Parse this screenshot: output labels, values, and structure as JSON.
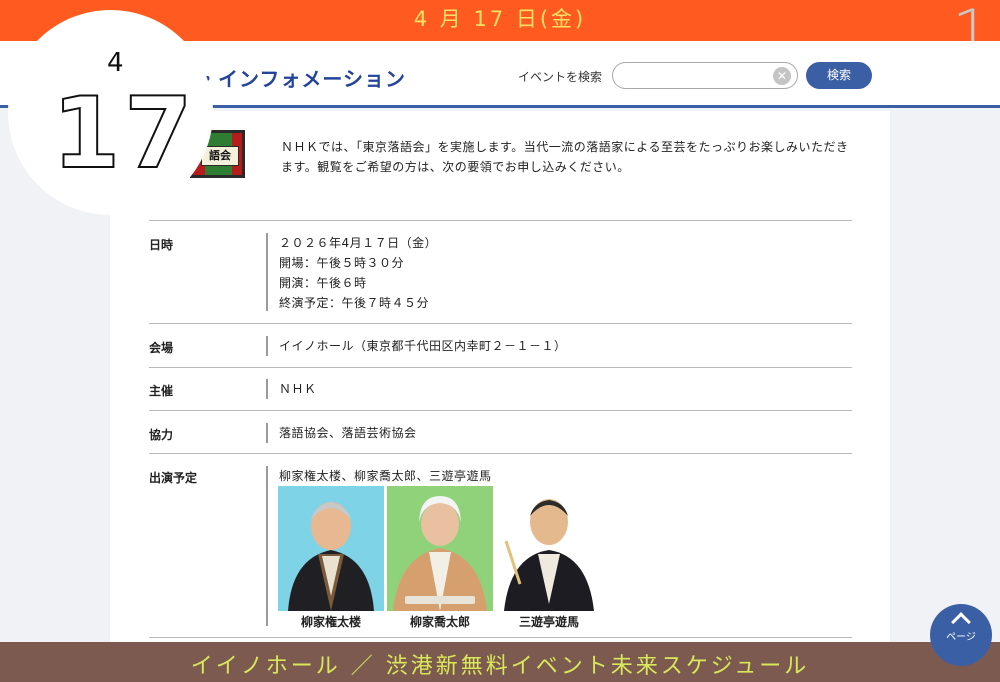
{
  "topbar": {
    "date": "4 月 17 日(金)",
    "corner_number": "1"
  },
  "header": {
    "title": "・インフォメーション",
    "search_label": "イベントを検索",
    "search_placeholder": "",
    "search_button": "検索",
    "clear_symbol": "✕"
  },
  "overlay": {
    "month": "4",
    "day": "17"
  },
  "logo": {
    "text": "語会"
  },
  "intro": "ＮＨＫでは、「東京落語会」を実施します。当代一流の落語家による至芸をたっぷりお楽しみいただきます。観覧をご希望の方は、次の要領でお申し込みください。",
  "details": {
    "datetime": {
      "label": "日時",
      "lines": [
        "２０２６年4月１７日（金）",
        "開場：午後５時３０分",
        "開演：午後６時",
        "終演予定：午後７時４５分"
      ]
    },
    "venue": {
      "label": "会場",
      "value": "イイノホール（東京都千代田区内幸町２－１－１）"
    },
    "organizer": {
      "label": "主催",
      "value": "ＮＨＫ"
    },
    "cooperation": {
      "label": "協力",
      "value": "落語協会、落語芸術協会"
    },
    "performers": {
      "label": "出演予定",
      "summary": "柳家権太楼、柳家喬太郎、三遊亭遊馬",
      "names": [
        "柳家権太楼",
        "柳家喬太郎",
        "三遊亭遊馬"
      ],
      "backgrounds": [
        "#7fd3e6",
        "#8fd27a",
        "#ffffff"
      ]
    }
  },
  "pagetop": {
    "label": "ページ"
  },
  "bottombar": {
    "text": "イイノホール ／ 渋港新無料イベント未来スケジュール"
  },
  "colors": {
    "orange": "#ff5a1f",
    "navy": "#3b5fa5",
    "brown": "#7d5a4f",
    "yellow": "#ffe066"
  }
}
